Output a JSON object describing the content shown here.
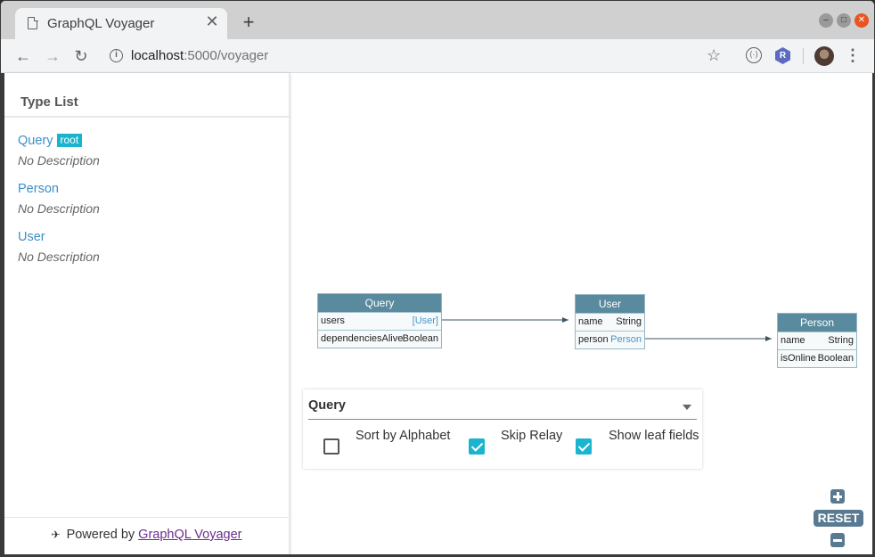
{
  "browser": {
    "tab_title": "GraphQL Voyager",
    "url_host": "localhost",
    "url_rest": ":5000/voyager",
    "ext2_label": "R"
  },
  "sidebar": {
    "title": "Type List",
    "types": [
      {
        "name": "Query",
        "badge": "root",
        "description": "No Description"
      },
      {
        "name": "Person",
        "description": "No Description"
      },
      {
        "name": "User",
        "description": "No Description"
      }
    ],
    "footer_prefix": "Powered by",
    "footer_link": "GraphQL Voyager"
  },
  "graph": {
    "nodes": {
      "query": {
        "title": "Query",
        "fields": [
          {
            "name": "users",
            "type": "[User]"
          },
          {
            "name": "dependenciesAlive",
            "type": "Boolean"
          }
        ]
      },
      "user": {
        "title": "User",
        "fields": [
          {
            "name": "name",
            "type": "String"
          },
          {
            "name": "person",
            "type": "Person"
          }
        ]
      },
      "person": {
        "title": "Person",
        "fields": [
          {
            "name": "name",
            "type": "String"
          },
          {
            "name": "isOnline",
            "type": "Boolean"
          }
        ]
      }
    },
    "colors": {
      "node_header": "#5a8a9e",
      "link": "#4595cc",
      "edge": "#3d5561"
    }
  },
  "settings": {
    "root_select": "Query",
    "options": [
      {
        "label": "Sort by Alphabet",
        "checked": false
      },
      {
        "label": "Skip Relay",
        "checked": true
      },
      {
        "label": "Show leaf fields",
        "checked": true
      }
    ]
  },
  "zoom": {
    "reset_label": "RESET"
  }
}
